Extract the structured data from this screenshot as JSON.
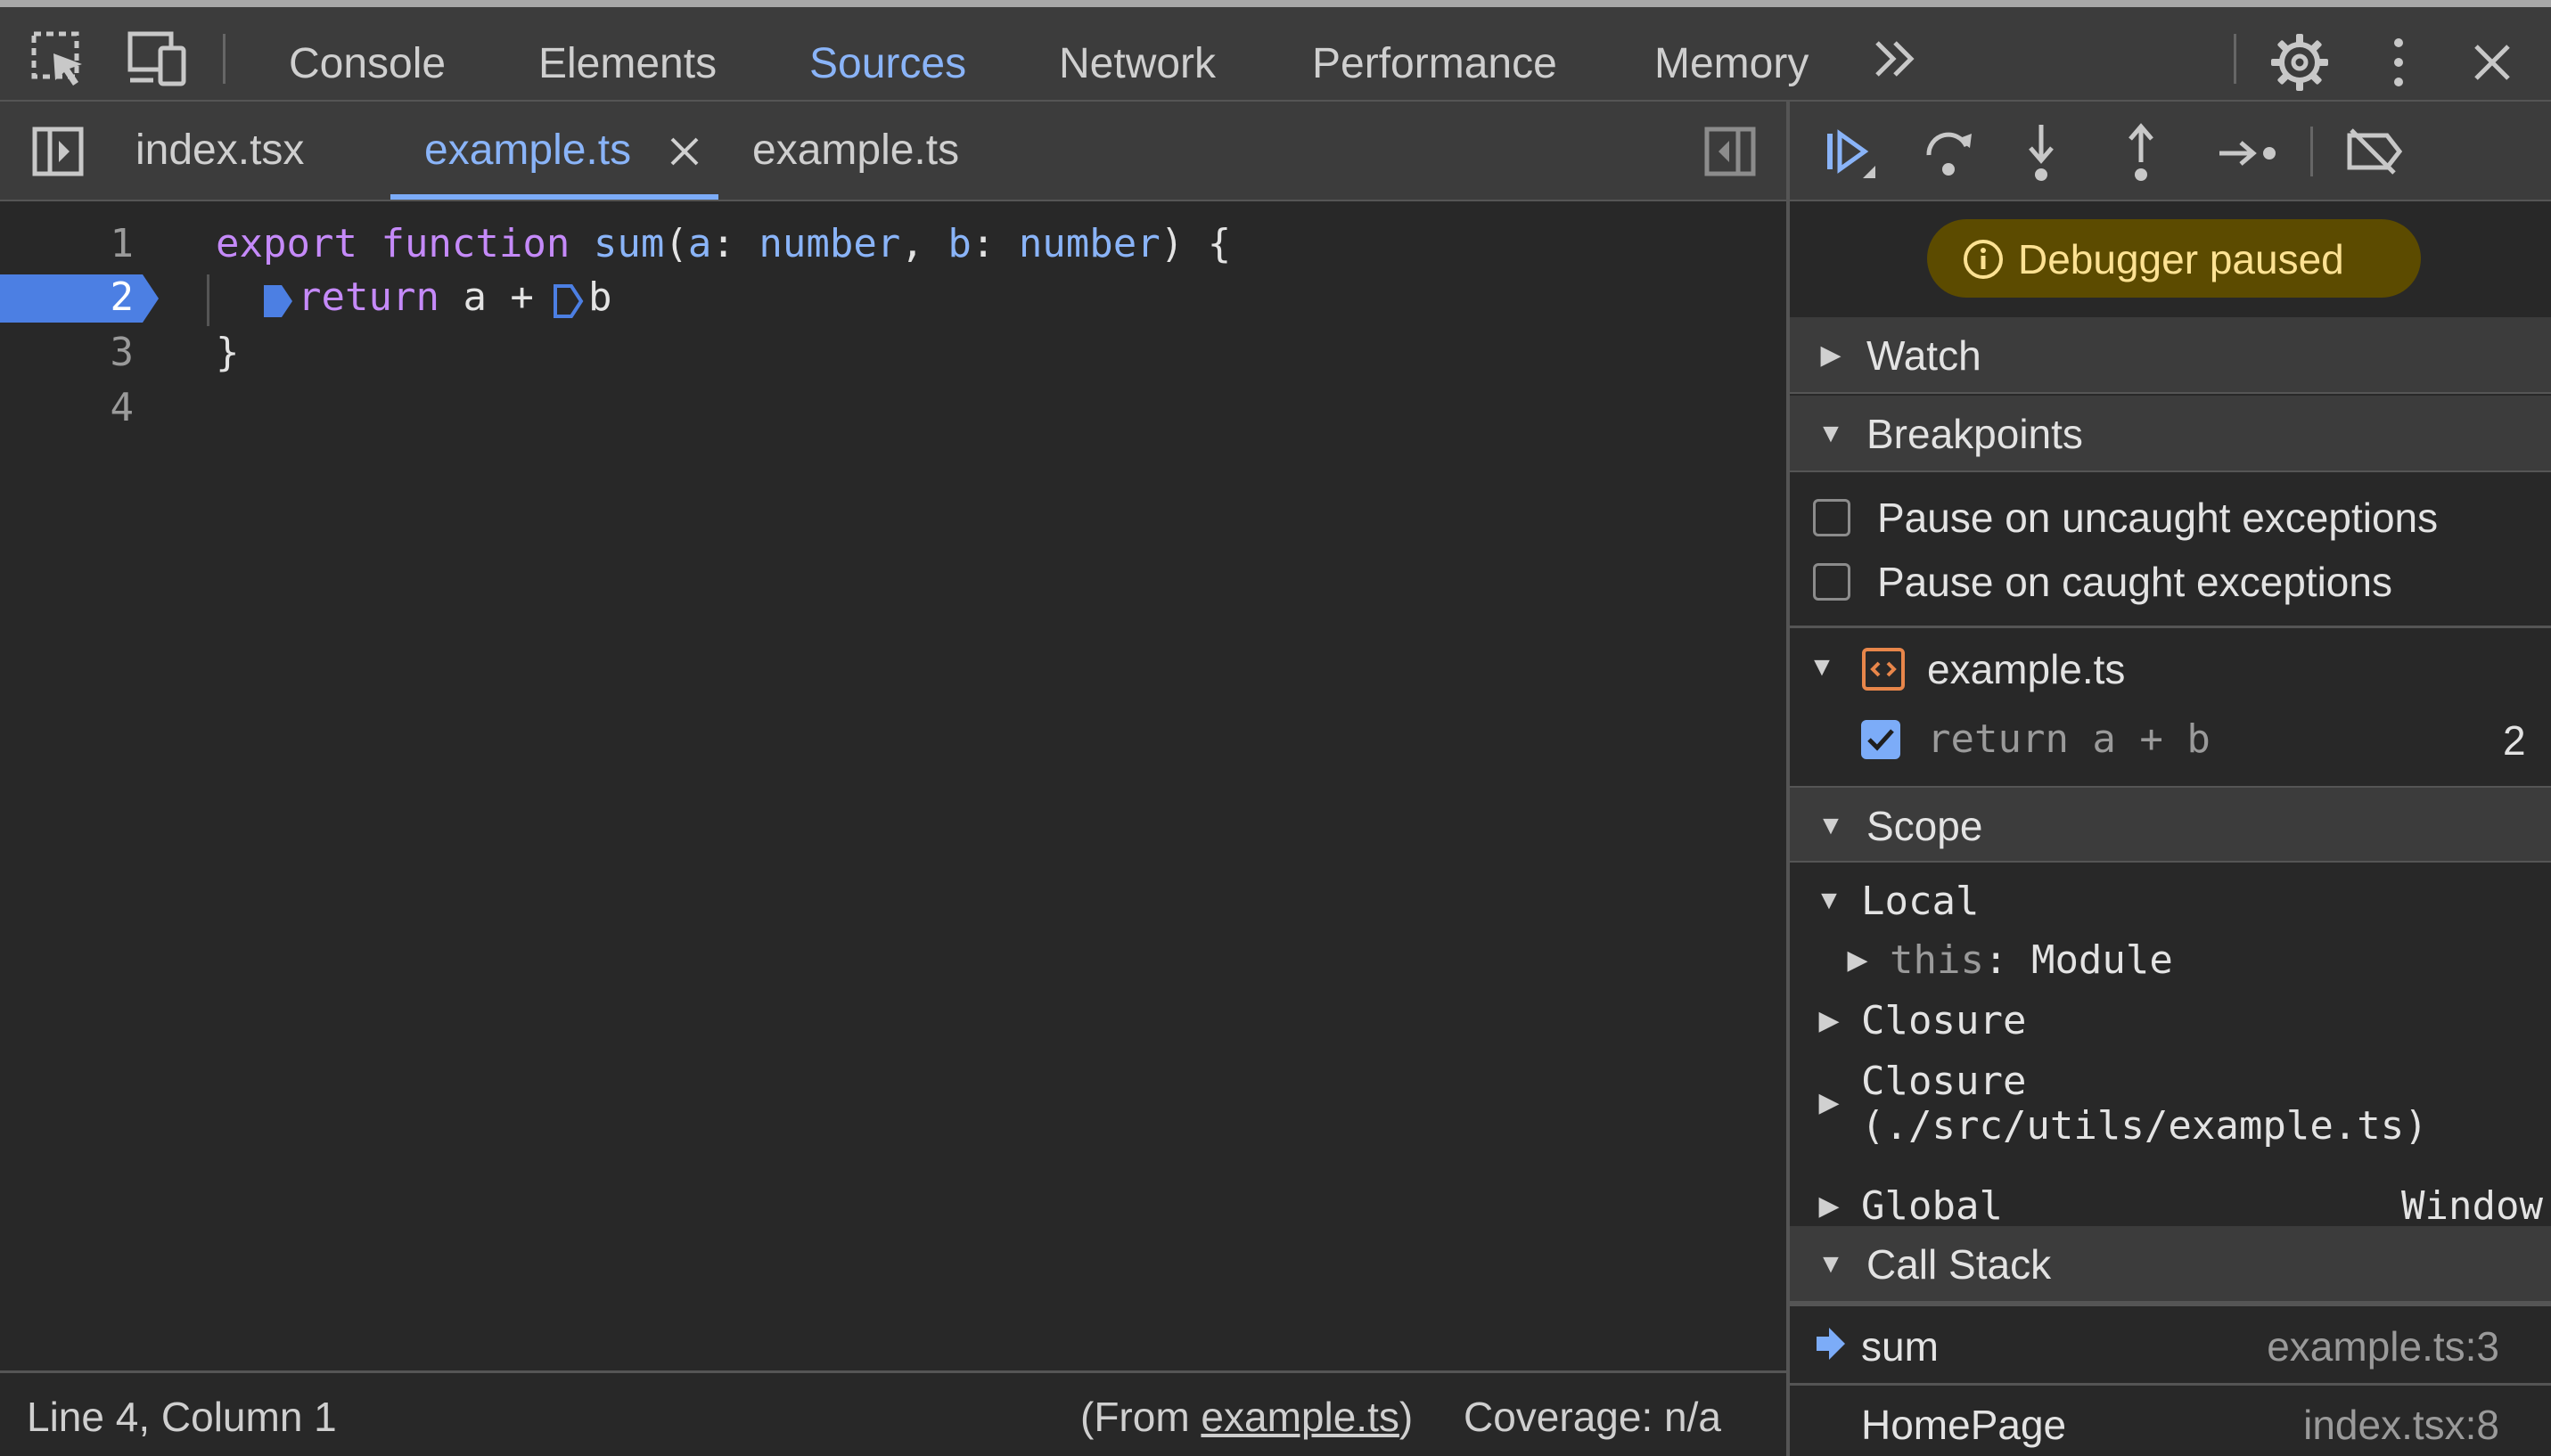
{
  "toolbar": {
    "tabs": [
      "Console",
      "Elements",
      "Sources",
      "Network",
      "Performance",
      "Memory"
    ],
    "active_tab": "Sources"
  },
  "files": {
    "tabs": [
      "index.tsx",
      "example.ts",
      "example.ts"
    ],
    "active_index": 1
  },
  "editor": {
    "line_numbers": [
      "1",
      "2",
      "3",
      "4"
    ],
    "current_line": "2",
    "code": {
      "line1": {
        "kw1": "export",
        "kw2": "function",
        "fn": "sum",
        "p1": "a",
        "t1": "number",
        "p2": "b",
        "t2": "number",
        "punct_open": "(",
        "colon": ":",
        "comma": ",",
        "close": ") {"
      },
      "line2": {
        "kw": "return",
        "rest": "a +",
        "b": "b"
      },
      "line3": "}"
    }
  },
  "status": {
    "position": "Line 4, Column 1",
    "from_prefix": "(From ",
    "from_file": "example.ts",
    "from_suffix": ")",
    "coverage": "Coverage: n/a"
  },
  "debugger": {
    "paused_label": "Debugger paused",
    "sections": {
      "watch": "Watch",
      "breakpoints": "Breakpoints",
      "scope": "Scope",
      "call_stack": "Call Stack"
    },
    "breakpoint_options": [
      "Pause on uncaught exceptions",
      "Pause on caught exceptions"
    ],
    "breakpoint_file": "example.ts",
    "breakpoint_entry": {
      "code": "return a + b",
      "line": "2"
    },
    "scope": {
      "local": "Local",
      "this_key": "this",
      "this_value": "Module",
      "closure": "Closure",
      "closure2_line1": "Closure",
      "closure2_line2": "(./src/utils/example.ts)",
      "global": "Global",
      "global_value": "Window"
    },
    "call_stack": [
      {
        "name": "sum",
        "location": "example.ts:3"
      },
      {
        "name": "HomePage",
        "location": "index.tsx:8"
      }
    ]
  },
  "colors": {
    "accent": "#8ab4f8",
    "keyword": "#c58af9",
    "paused_badge_bg": "#5c4b00",
    "paused_badge_text": "#fde293",
    "breakpoint_marker": "#4c7fe3"
  }
}
